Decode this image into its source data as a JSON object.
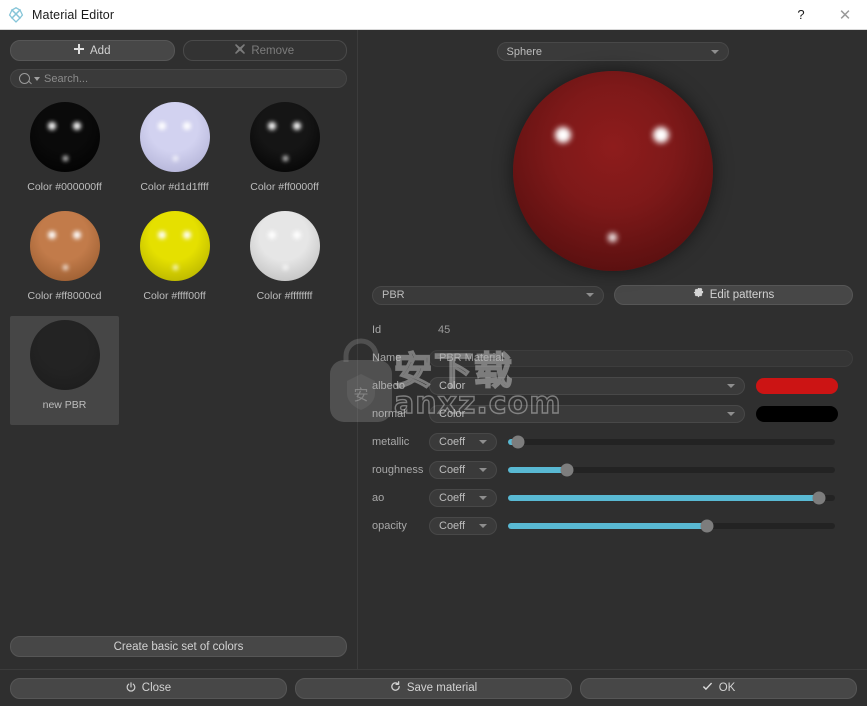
{
  "window": {
    "title": "Material Editor",
    "icon": "atom-icon",
    "help_label": "?",
    "close_label": "✕"
  },
  "left_panel": {
    "add_button": {
      "label": "Add",
      "icon": "plus-icon"
    },
    "remove_button": {
      "label": "Remove",
      "icon": "cross-icon",
      "disabled": true
    },
    "search": {
      "placeholder": "Search...",
      "value": "",
      "icon": "search-icon"
    },
    "materials": [
      {
        "label": "Color #000000ff",
        "base": "#0a0a0a",
        "edge": "#000000",
        "selected": false
      },
      {
        "label": "Color #d1d1ffff",
        "base": "#d2d2f0",
        "edge": "#a9a9cf",
        "selected": false
      },
      {
        "label": "Color #ff0000ff",
        "base": "#151515",
        "edge": "#000000",
        "selected": false
      },
      {
        "label": "Color #ff8000cd",
        "base": "#c27b4a",
        "edge": "#8d5328",
        "selected": false
      },
      {
        "label": "Color #ffff00ff",
        "base": "#e5e000",
        "edge": "#a8a400",
        "selected": false
      },
      {
        "label": "Color #ffffffff",
        "base": "#e6e6e6",
        "edge": "#b4b4b4",
        "selected": false
      },
      {
        "label": "new PBR",
        "base": "#232323",
        "edge": "#1b1b1b",
        "selected": true
      }
    ],
    "create_colors_button": {
      "label": "Create basic set of colors"
    }
  },
  "right_panel": {
    "shape_select": {
      "value": "Sphere",
      "icon": "chevron-down-icon"
    },
    "preview": {
      "material_color": "#7e1919",
      "highlight_color": "#ffffff"
    },
    "type_select": {
      "value": "PBR",
      "icon": "chevron-down-icon"
    },
    "edit_patterns_button": {
      "label": "Edit patterns",
      "icon": "gear-icon"
    },
    "fields": {
      "id_label": "Id",
      "id_value": "45",
      "name_label": "Name",
      "name_value": "PBR Material"
    },
    "properties": [
      {
        "name": "albedo",
        "mode": "Color",
        "kind": "color",
        "color": "#cc1414"
      },
      {
        "name": "normal",
        "mode": "Color",
        "kind": "color",
        "color": "#000000"
      },
      {
        "name": "metallic",
        "mode": "Coeff",
        "kind": "slider",
        "value": 3
      },
      {
        "name": "roughness",
        "mode": "Coeff",
        "kind": "slider",
        "value": 18
      },
      {
        "name": "ao",
        "mode": "Coeff",
        "kind": "slider",
        "value": 95
      },
      {
        "name": "opacity",
        "mode": "Coeff",
        "kind": "slider",
        "value": 61
      }
    ],
    "slider_accent": "#59b9d3"
  },
  "footer": {
    "close_button": {
      "label": "Close",
      "icon": "power-icon"
    },
    "save_button": {
      "label": "Save material",
      "icon": "refresh-icon"
    },
    "ok_button": {
      "label": "OK",
      "icon": "check-icon"
    }
  },
  "watermark": {
    "chinese": "安下载",
    "site": "anxz.com"
  }
}
